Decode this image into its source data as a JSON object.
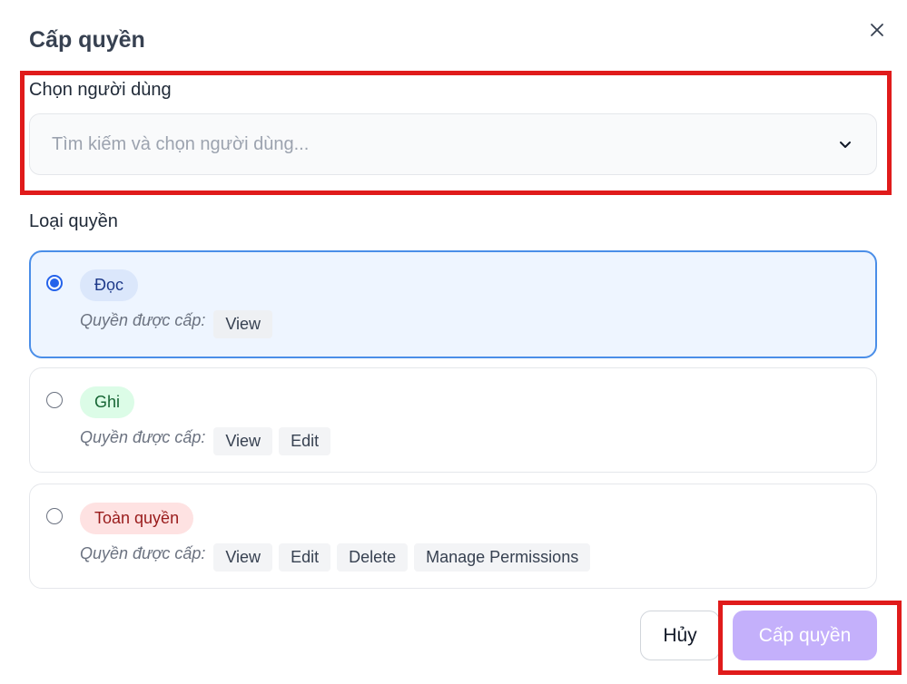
{
  "dialog": {
    "title": "Cấp quyền"
  },
  "user_field": {
    "label": "Chọn người dùng",
    "placeholder": "Tìm kiếm và chọn người dùng..."
  },
  "permission_type": {
    "label": "Loại quyền",
    "granted_label": "Quyền được cấp:",
    "options": [
      {
        "name": "Đọc",
        "color": "#1e3a8a",
        "selected": true,
        "permissions": [
          "View"
        ]
      },
      {
        "name": "Ghi",
        "color": "#166534",
        "selected": false,
        "permissions": [
          "View",
          "Edit"
        ]
      },
      {
        "name": "Toàn quyền",
        "color": "#991b1b",
        "selected": false,
        "permissions": [
          "View",
          "Edit",
          "Delete",
          "Manage Permissions"
        ]
      }
    ]
  },
  "actions": {
    "cancel_label": "Hủy",
    "submit_label": "Cấp quyền"
  },
  "colors": {
    "accent": "#2563eb",
    "submit_bg": "#c4b0fb",
    "highlight": "#e01b1b"
  },
  "icons": {
    "close": "close-icon",
    "dropdown": "chevron-down-icon"
  }
}
